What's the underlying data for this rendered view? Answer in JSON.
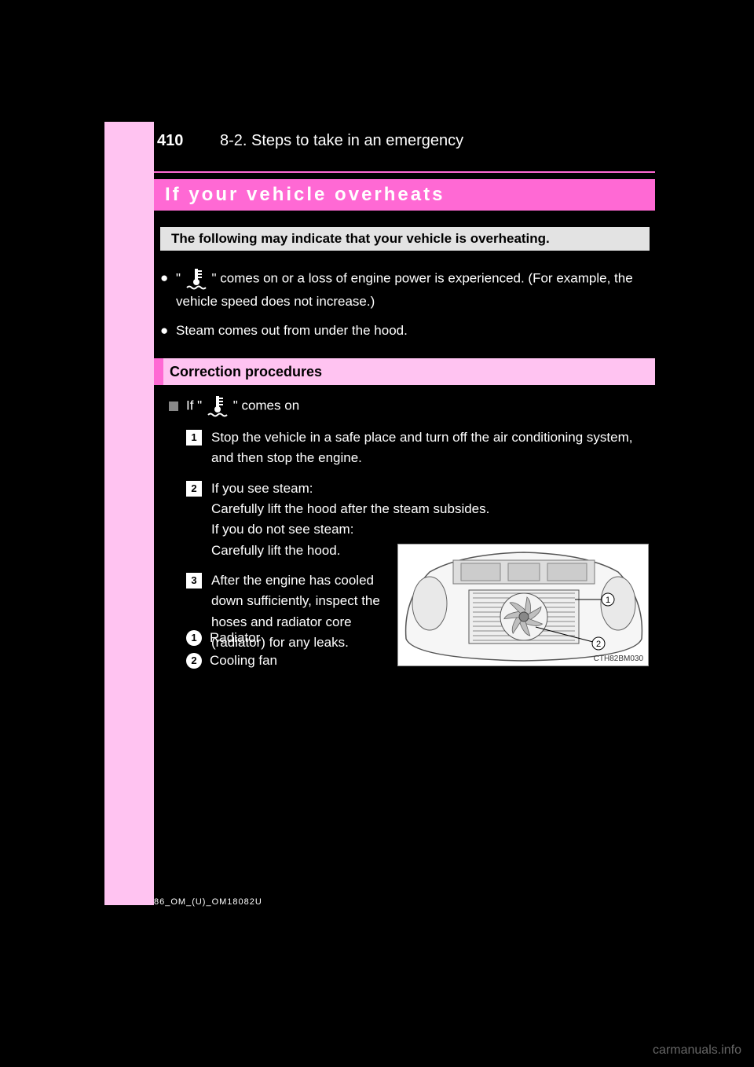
{
  "page_number": "410",
  "section_label": "8-2. Steps to take in an emergency",
  "title": "If your vehicle overheats",
  "intro": "The following may indicate that your vehicle is overheating.",
  "bullets": {
    "b1_pre": "\"",
    "b1_post": "\" comes on or a loss of engine power is experienced. (For example, the vehicle speed does not increase.)",
    "b2": "Steam comes out from under the hood."
  },
  "subheader": "Correction procedures",
  "proc_heading_pre": "If \"",
  "proc_heading_post": "\" comes on",
  "steps": {
    "s1": "Stop the vehicle in a safe place and turn off the air conditioning system, and then stop the engine.",
    "s2_a": "If you see steam:",
    "s2_b": "Carefully lift the hood after the steam subsides.",
    "s2_c": "If you do not see steam:",
    "s2_d": "Carefully lift the hood.",
    "s3": "After the engine has cooled down sufficiently, inspect the hoses and radiator core (radiator) for any leaks."
  },
  "callouts": {
    "c1": "Radiator",
    "c2": "Cooling fan"
  },
  "icon_name": "engine-temp-icon",
  "figure_code": "CTH82BM030",
  "footer_code": "86_OM_(U)_OM18082U",
  "watermark": "carmanuals.info"
}
